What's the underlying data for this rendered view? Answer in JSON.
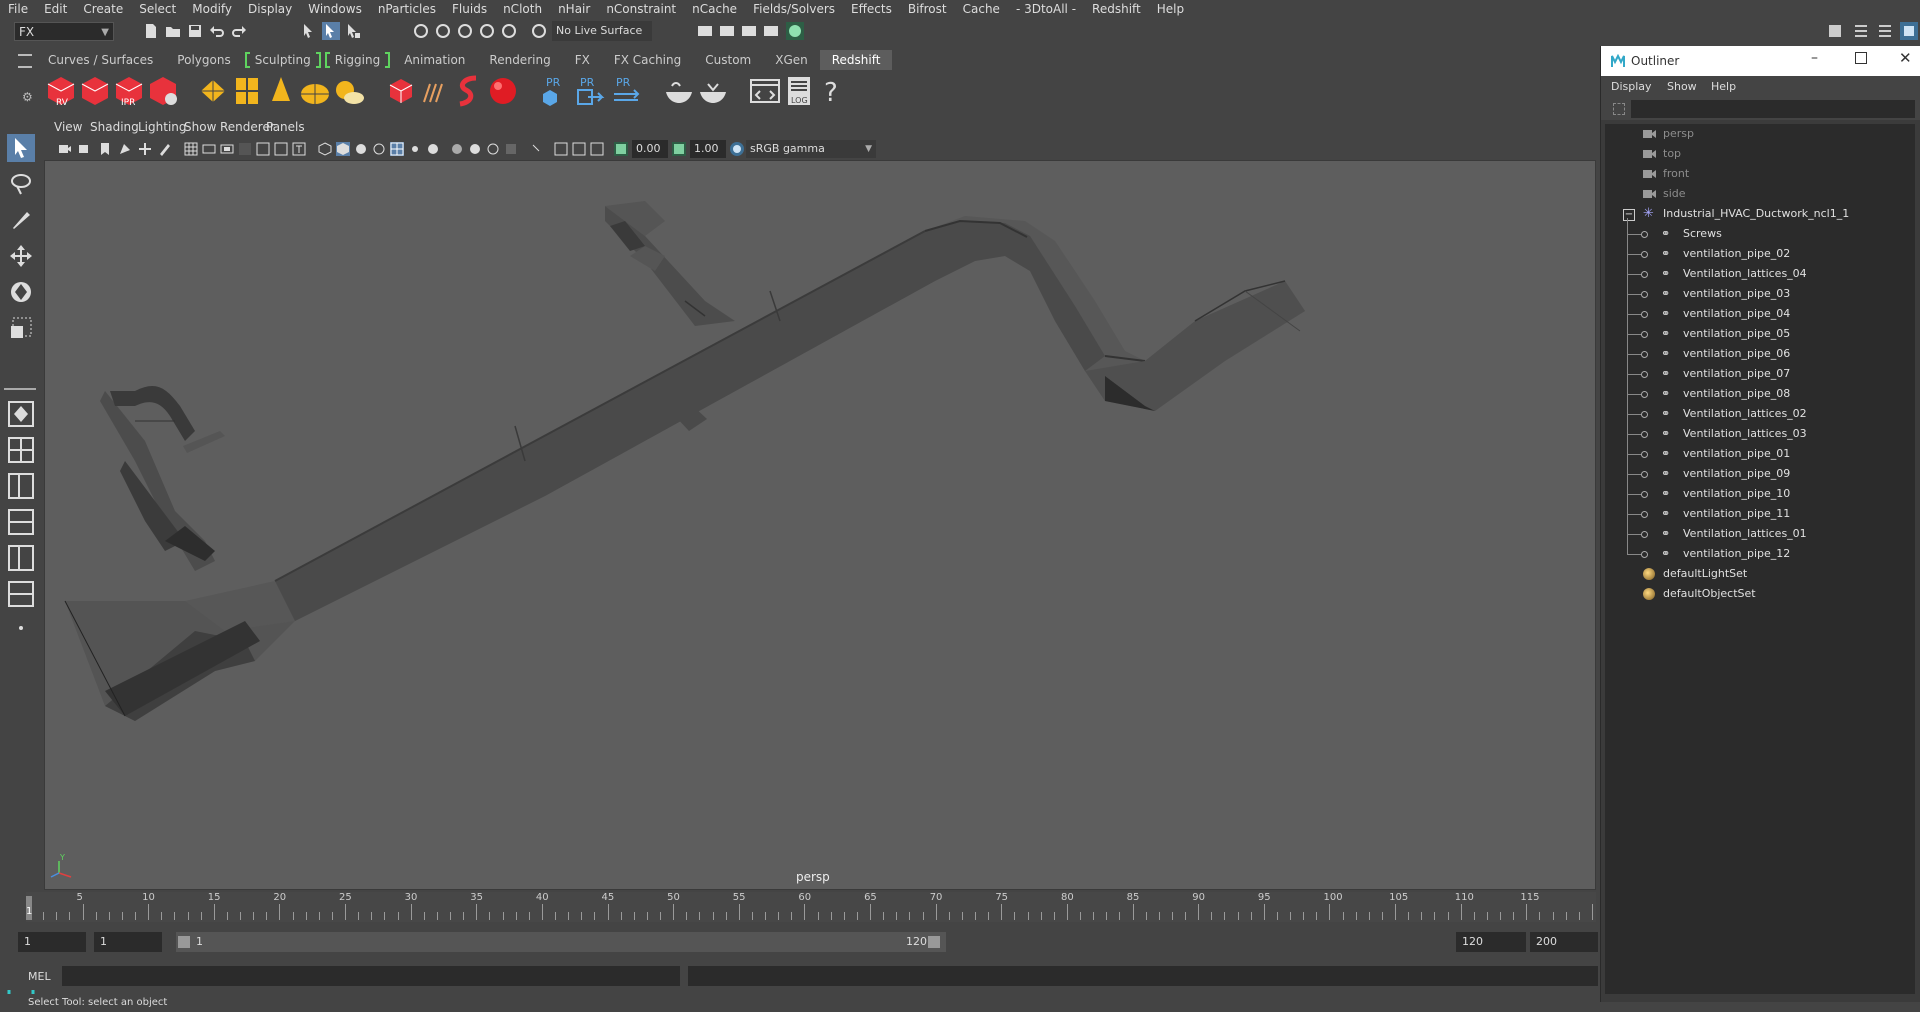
{
  "menubar": [
    "File",
    "Edit",
    "Create",
    "Select",
    "Modify",
    "Display",
    "Windows",
    "nParticles",
    "Fluids",
    "nCloth",
    "nHair",
    "nConstraint",
    "nCache",
    "Fields/Solvers",
    "Effects",
    "Bifrost",
    "Cache",
    "- 3DtoAll -",
    "Redshift",
    "Help"
  ],
  "status_line": {
    "mode": "FX",
    "live_surface": "No Live Surface"
  },
  "shelf_tabs": [
    "Curves / Surfaces",
    "Polygons",
    "Sculpting",
    "Rigging",
    "Animation",
    "Rendering",
    "FX",
    "FX Caching",
    "Custom",
    "XGen",
    "Redshift"
  ],
  "shelf_active": "Redshift",
  "shelf_icon_labels": {
    "rv": "RV",
    "ipr": "IPR",
    "pr": "PR",
    "log": "LOG",
    "help": "?"
  },
  "panel_menu": [
    "View",
    "Shading",
    "Lighting",
    "Show",
    "Renderer",
    "Panels"
  ],
  "viewport_toolbar": {
    "exposure": "0.00",
    "gamma": "1.00",
    "color_space": "sRGB gamma"
  },
  "camera_label": "persp",
  "axis_label": "Y",
  "timeline": {
    "ticks": [
      "5",
      "10",
      "15",
      "20",
      "25",
      "30",
      "35",
      "40",
      "45",
      "50",
      "55",
      "60",
      "65",
      "70",
      "75",
      "80",
      "85",
      "90",
      "95",
      "100",
      "105",
      "110",
      "115"
    ],
    "current": "1"
  },
  "range": {
    "start": "1",
    "playback_start": "1",
    "slider_start": "1",
    "slider_end": "120",
    "playback_end": "120",
    "end": "200"
  },
  "command_line": {
    "label": "MEL"
  },
  "help_line": "Select Tool: select an object",
  "outliner": {
    "title": "Outliner",
    "menu": [
      "Display",
      "Show",
      "Help"
    ],
    "cameras": [
      "persp",
      "top",
      "front",
      "side"
    ],
    "group": "Industrial_HVAC_Ductwork_ncl1_1",
    "children": [
      "Screws",
      "ventilation_pipe_02",
      "Ventilation_lattices_04",
      "ventilation_pipe_03",
      "ventilation_pipe_04",
      "ventilation_pipe_05",
      "ventilation_pipe_06",
      "ventilation_pipe_07",
      "ventilation_pipe_08",
      "Ventilation_lattices_02",
      "Ventilation_lattices_03",
      "ventilation_pipe_01",
      "ventilation_pipe_09",
      "ventilation_pipe_10",
      "ventilation_pipe_11",
      "Ventilation_lattices_01",
      "ventilation_pipe_12"
    ],
    "sets": [
      "defaultLightSet",
      "defaultObjectSet"
    ]
  },
  "colors": {
    "ui_bg": "#444444",
    "viewport_bg": "#5e5e5e",
    "accent_green": "#5fd35f",
    "redshift_red": "#e8323c",
    "shelf_yellow": "#f2b51d"
  }
}
